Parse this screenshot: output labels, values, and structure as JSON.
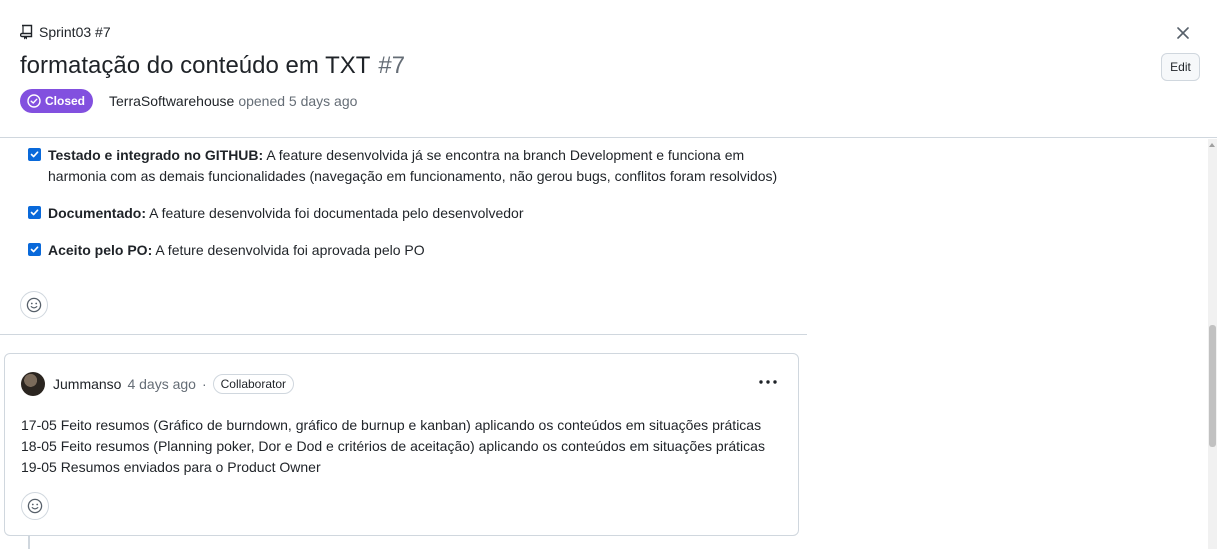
{
  "header": {
    "repo_label": "Sprint03 #7",
    "title": "formatação do conteúdo em TXT",
    "issue_number": "#7",
    "state": "Closed",
    "author": "TerraSoftwarehouse",
    "opened_text": "opened 5 days ago",
    "edit_label": "Edit",
    "state_color": "#8250df"
  },
  "tasks": [
    {
      "bold": "Testado e integrado no GITHUB:",
      "text": " A feature desenvolvida já se encontra na branch Development e funciona em",
      "text2": "harmonia com as demais funcionalidades (navegação em funcionamento, não gerou bugs, conflitos foram resolvidos)",
      "checked": true
    },
    {
      "bold": "Documentado:",
      "text": " A feature desenvolvida foi documentada pelo desenvolvedor",
      "checked": true
    },
    {
      "bold": "Aceito pelo PO:",
      "text": " A feture desenvolvida foi aprovada pelo PO",
      "checked": true
    }
  ],
  "comment": {
    "author": "Jummanso",
    "time": "4 days ago",
    "separator": "·",
    "role": "Collaborator",
    "lines": [
      "17-05 Feito resumos (Gráfico de burndown, gráfico de burnup e kanban) aplicando os conteúdos em situações práticas",
      "18-05 Feito resumos (Planning poker, Dor e Dod e critérios de aceitação) aplicando os conteúdos em situações práticas",
      "19-05 Resumos enviados para o Product Owner"
    ]
  },
  "icons": {
    "repo": "repo-icon",
    "close": "close-icon",
    "state": "check-circle-icon",
    "reaction": "smiley-icon",
    "menu": "kebab-horizontal-icon"
  },
  "colors": {
    "accent": "#0969da",
    "border": "#d0d7de",
    "muted": "#656d76"
  }
}
